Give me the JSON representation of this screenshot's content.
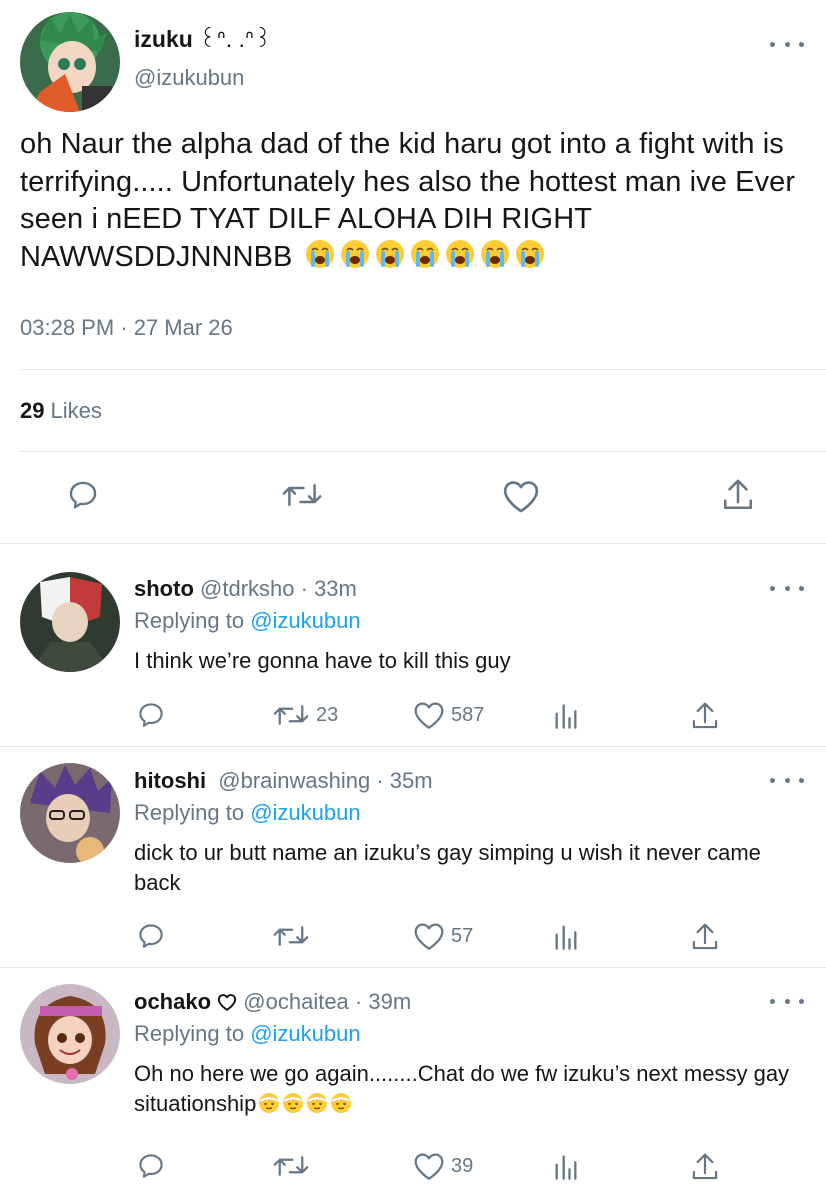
{
  "main_tweet": {
    "display_name": "izuku",
    "name_decoration": "꒰ᐢ. .ᐢ꒱",
    "handle": "@izukubun",
    "text": "oh Naur the alpha dad of the kid haru got into a fight with is terrifying..... Unfortunately hes also the hottest man ive Ever seen i nEED TYAT DILF ALOHA DIH RIGHT NAWWSDDJNNNBB",
    "emoji_icons": [
      "loudly-crying-face",
      "loudly-crying-face",
      "loudly-crying-face",
      "loudly-crying-face",
      "loudly-crying-face",
      "loudly-crying-face",
      "loudly-crying-face"
    ],
    "timestamp": "03:28 PM · 27 Mar 26",
    "likes_count": "29",
    "likes_label": "Likes"
  },
  "replies": [
    {
      "display_name": "shoto",
      "handle": "@tdrksho",
      "time": "· 33m",
      "replying_prefix": "Replying to",
      "replying_to": "@izukubun",
      "text": "I think we’re gonna have to kill this guy",
      "retweets": "23",
      "likes": "587"
    },
    {
      "display_name": "hitoshi",
      "handle": "@brainwashing",
      "time": "· 35m",
      "replying_prefix": "Replying to",
      "replying_to": "@izukubun",
      "text": "dick to ur butt name an izuku’s gay simping u wish it never came back",
      "retweets": "",
      "likes": "57"
    },
    {
      "display_name": "ochako",
      "name_icon": "heart-outline-icon",
      "handle": "@ochaitea",
      "time": "· 39m",
      "replying_prefix": "Replying to",
      "replying_to": "@izukubun",
      "text": "Oh no here we go again........Chat do we fw izuku’s next messy gay situationship",
      "emoji_icons": [
        "face-with-head-bandage",
        "face-with-head-bandage",
        "face-with-head-bandage",
        "face-with-head-bandage"
      ],
      "retweets": "",
      "likes": "39"
    }
  ],
  "colors": {
    "text": "#14171a",
    "secondary": "#657786",
    "link": "#1da1f2",
    "divider": "#e1e8ed"
  }
}
